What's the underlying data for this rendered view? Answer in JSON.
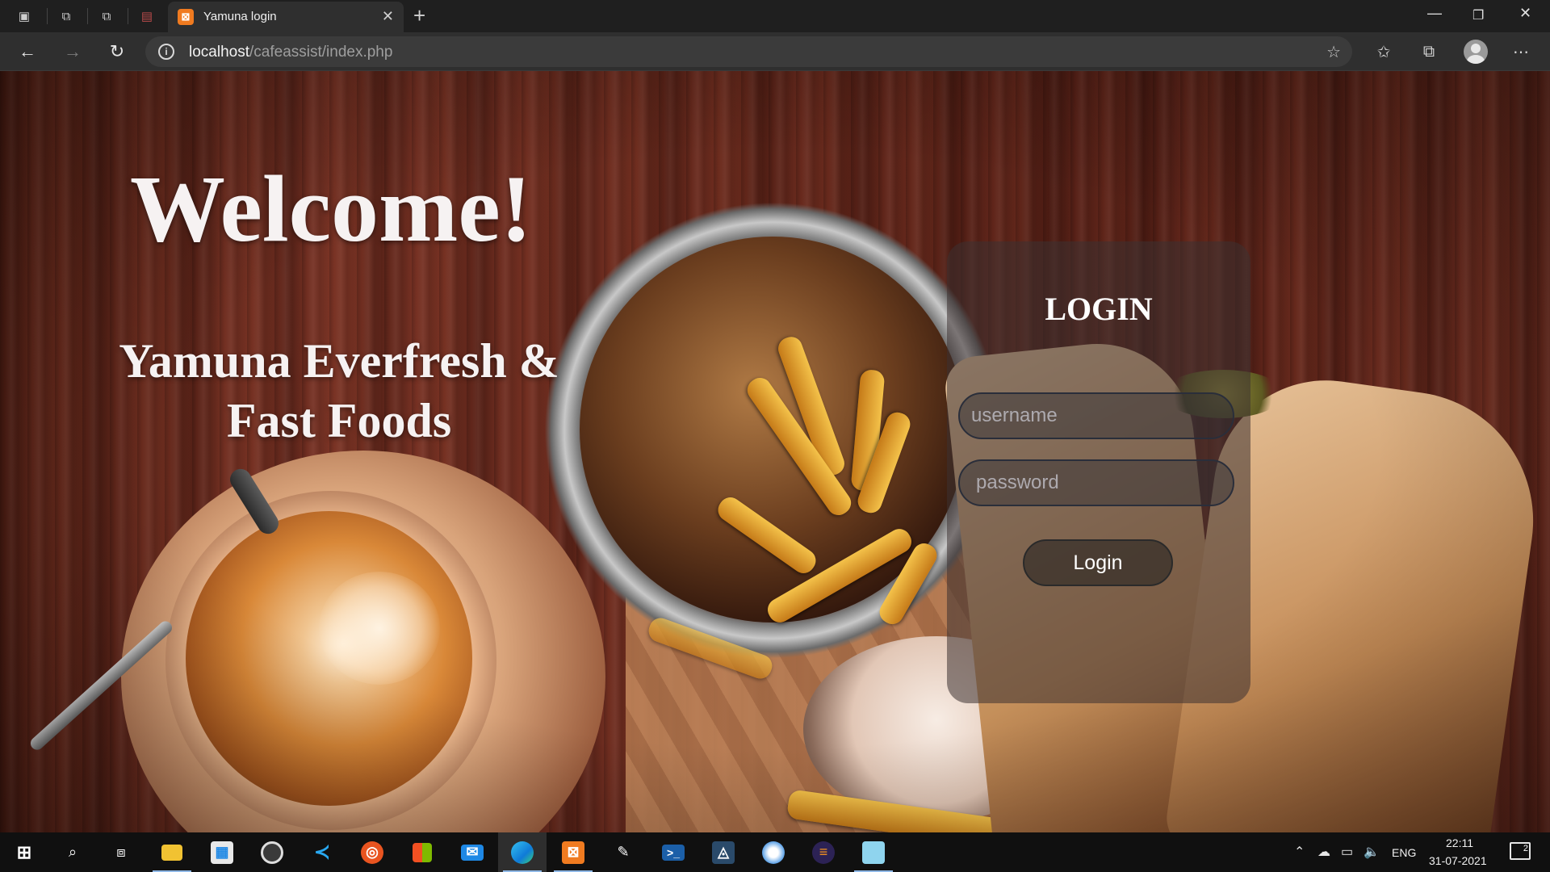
{
  "browser": {
    "tab": {
      "title": "Yamuna login",
      "favicon": "xampp-icon"
    },
    "address": {
      "host": "localhost",
      "path": "/cafeassist/index.php"
    },
    "icons": {
      "left": [
        "tab-actions-icon",
        "workspace-icon",
        "workspace-icon",
        "collections-tab-icon"
      ],
      "toolbar": [
        "back-icon",
        "forward-icon",
        "refresh-icon",
        "favorites-add-icon",
        "favorites-icon",
        "collections-icon",
        "profile-avatar",
        "more-icon"
      ],
      "window": [
        "minimize-icon",
        "restore-icon",
        "close-icon"
      ]
    }
  },
  "page": {
    "welcome": "Welcome!",
    "brand_line1": "Yamuna Everfresh &",
    "brand_line2": "Fast Foods",
    "login": {
      "title": "LOGIN",
      "username_placeholder": "username",
      "password_placeholder": "password",
      "button": "Login"
    }
  },
  "taskbar": {
    "apps": [
      "start-icon",
      "search-icon",
      "task-view-icon",
      "file-explorer-icon",
      "store-icon",
      "obs-icon",
      "vscode-icon",
      "ubuntu-icon",
      "office-icon",
      "mail-icon",
      "edge-icon",
      "xampp-icon",
      "pen-tool-icon",
      "powershell-icon",
      "mysql-workbench-icon",
      "paint-icon",
      "eclipse-icon",
      "notepad-icon"
    ],
    "tray": {
      "language": "ENG",
      "time": "22:11",
      "date": "31-07-2021",
      "notifications": "2"
    }
  }
}
